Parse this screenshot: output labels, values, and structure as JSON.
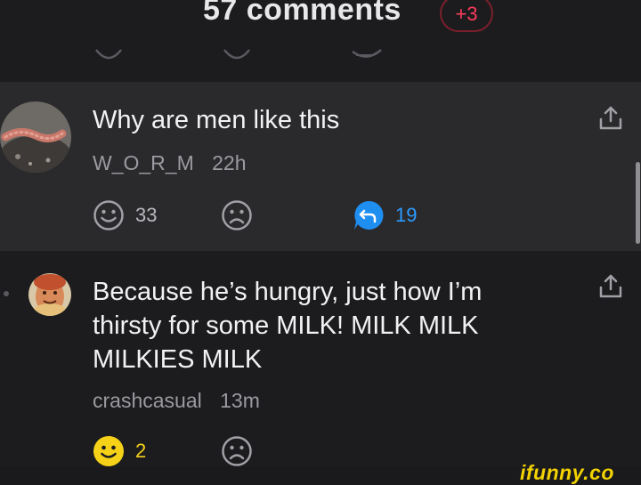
{
  "header": {
    "title": "57 comments",
    "new_badge": "+3"
  },
  "comments": [
    {
      "text": "Why are men like this",
      "username": "W_O_R_M",
      "time": "22h",
      "smile_count": "33",
      "reply_count": "19",
      "avatar": "worm-photo"
    },
    {
      "text_lines": [
        "Because he’s hungry, just how I’m",
        "thirsty for some MILK! MILK MILK",
        "MILKIES MILK"
      ],
      "username": "crashcasual",
      "time": "13m",
      "smile_count": "2",
      "avatar": "hotdog-face"
    }
  ],
  "icons": {
    "share": "share-icon",
    "smile": "smile-icon",
    "frown": "frown-icon",
    "reply": "reply-icon"
  },
  "colors": {
    "accent_red": "#ff3b5c",
    "reply_blue": "#1f8ef1",
    "smile_yellow": "#f5d218",
    "watermark_yellow": "#f2d200"
  },
  "watermark": "ifunny.co"
}
